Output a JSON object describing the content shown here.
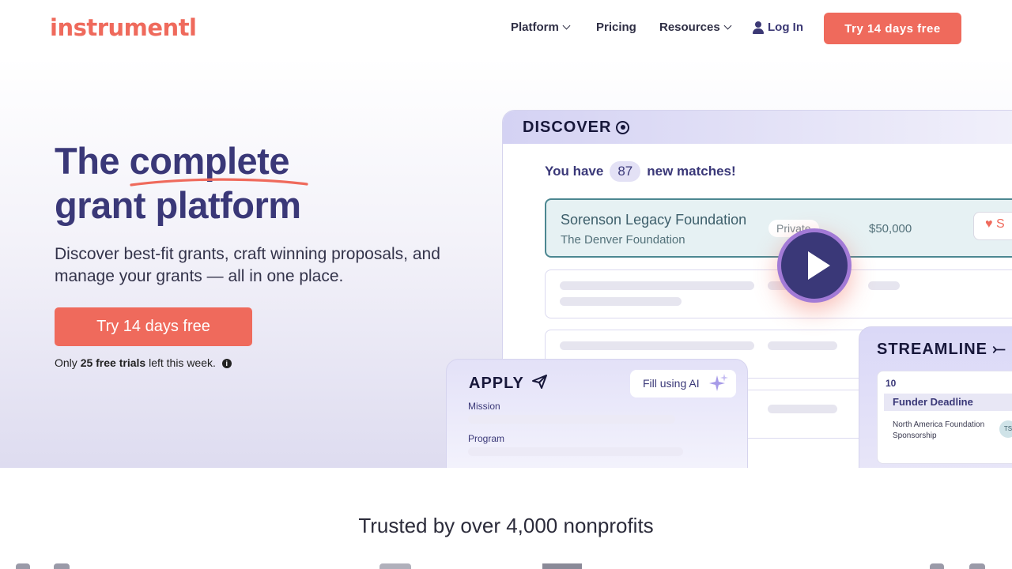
{
  "header": {
    "logo_text": "instrumentl",
    "nav": {
      "platform": "Platform",
      "pricing": "Pricing",
      "resources": "Resources",
      "login": "Log In"
    },
    "cta": "Try 14 days free"
  },
  "hero": {
    "title_line1_plain": "The",
    "title_line1_emph": "complete",
    "title_line2": "grant platform",
    "subtitle": "Discover best-fit grants, craft winning proposals, and manage your grants — all in one place.",
    "cta": "Try 14 days free",
    "note_prefix": "Only",
    "note_bold": "25 free trials",
    "note_suffix": "left this week."
  },
  "discover": {
    "heading": "DISCOVER",
    "matches_prefix": "You have",
    "matches_count": "87",
    "matches_suffix": "new matches!",
    "first_result": {
      "name": "Sorenson Legacy Foundation",
      "sub": "The Denver Foundation",
      "badge": "Private",
      "amount": "$50,000",
      "save": "S"
    }
  },
  "apply": {
    "heading": "APPLY",
    "fill_ai": "Fill using AI",
    "field1": "Mission",
    "field2": "Program"
  },
  "streamline": {
    "heading": "STREAMLINE",
    "day": "10",
    "deadline": "Funder Deadline",
    "item": "North America Foundation Sponsorship",
    "avatar": "TS"
  },
  "trusted": {
    "heading": "Trusted by over 4,000 nonprofits"
  },
  "colors": {
    "brand": "#ef6a5c",
    "primary": "#3a3878"
  }
}
